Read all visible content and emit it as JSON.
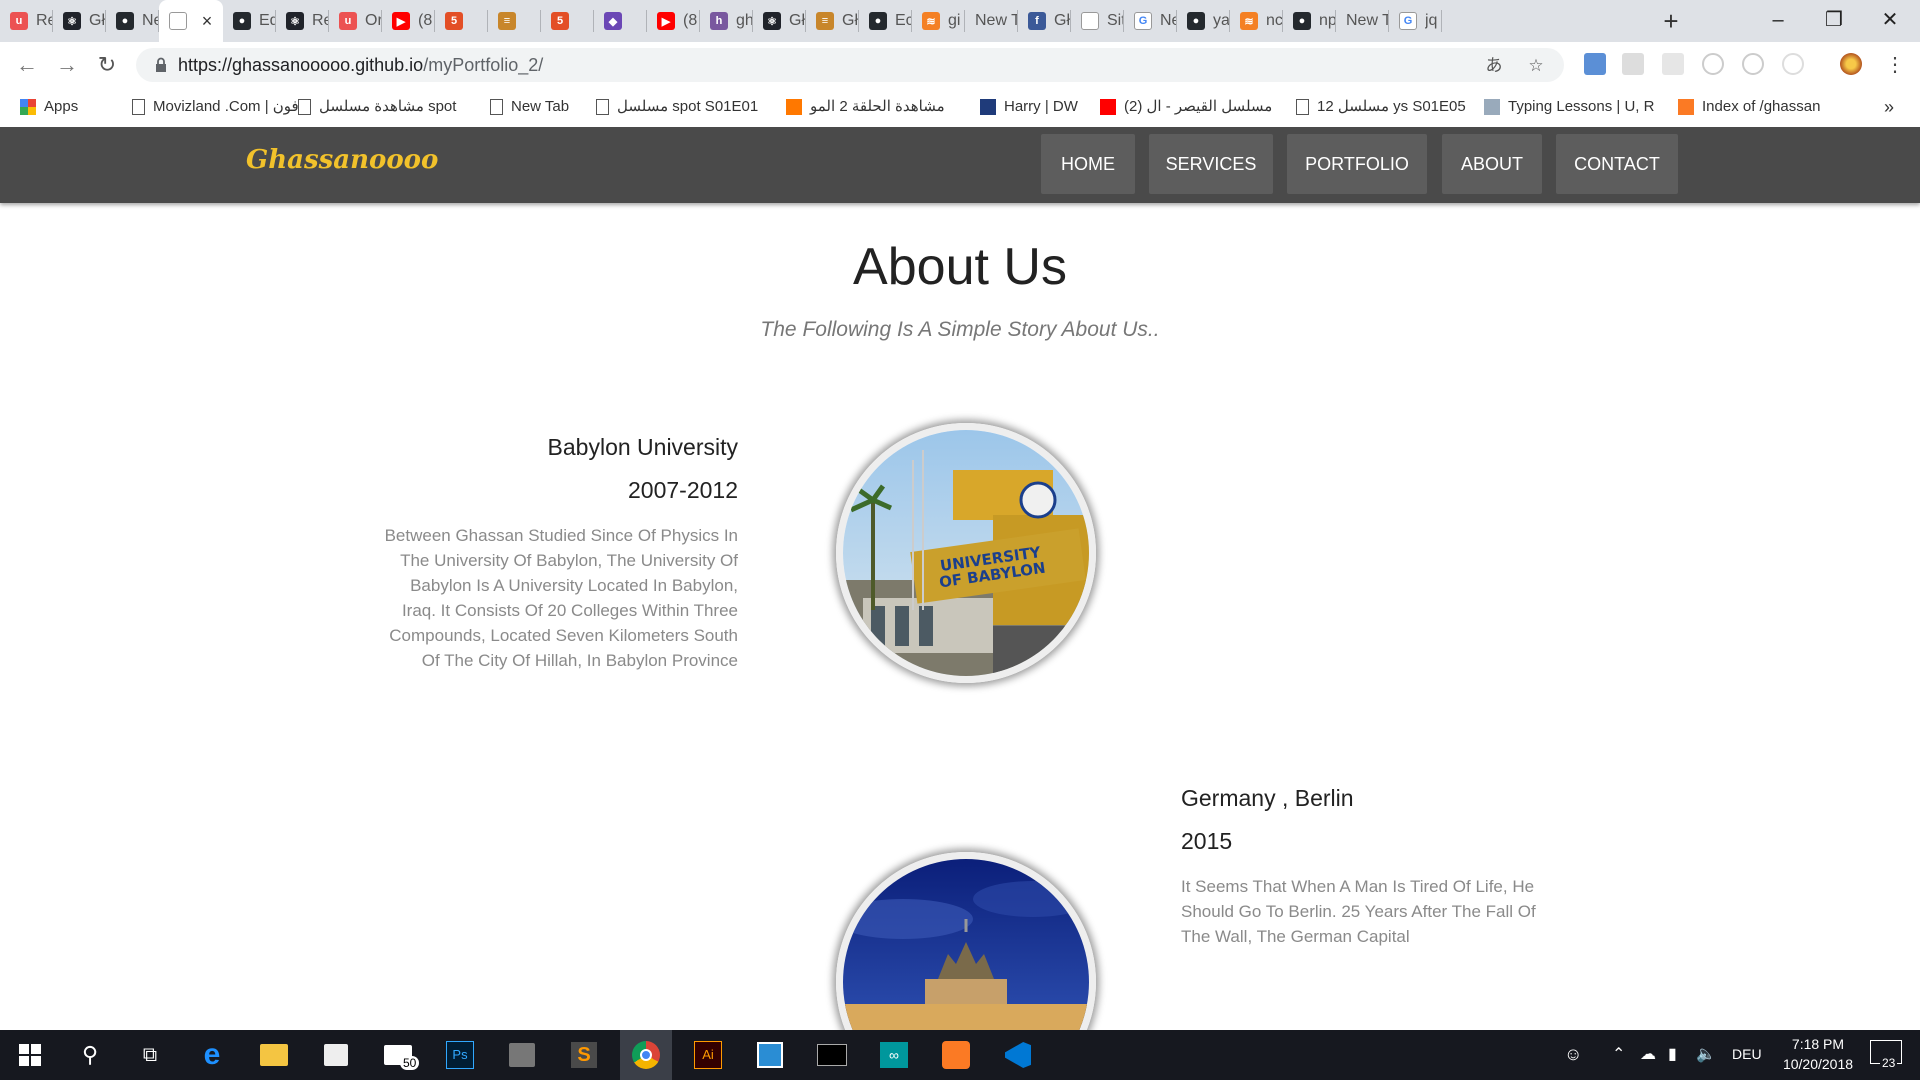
{
  "browser": {
    "tabs": [
      {
        "title": "Re",
        "favicon": "udemy-icon",
        "color": "#ec5252",
        "glyph": "u"
      },
      {
        "title": "Gł",
        "favicon": "react-icon",
        "color": "#20232a",
        "glyph": "⚛"
      },
      {
        "title": "Ne",
        "favicon": "github-icon",
        "color": "#24292e",
        "glyph": "●"
      },
      {
        "title": "",
        "favicon": "page-icon",
        "color": "#ffffff",
        "glyph": "",
        "active": true
      },
      {
        "title": "Ed",
        "favicon": "github-icon",
        "color": "#24292e",
        "glyph": "●"
      },
      {
        "title": "Re",
        "favicon": "react-icon",
        "color": "#20232a",
        "glyph": "⚛"
      },
      {
        "title": "Or",
        "favicon": "udemy-icon",
        "color": "#ec5252",
        "glyph": "u"
      },
      {
        "title": "(8",
        "favicon": "youtube-icon",
        "color": "#ff0000",
        "glyph": "▶"
      },
      {
        "title": "",
        "favicon": "html5-icon",
        "color": "#e34f26",
        "glyph": "5"
      },
      {
        "title": "",
        "favicon": "burger-icon",
        "color": "#c8862b",
        "glyph": "≡"
      },
      {
        "title": "",
        "favicon": "html5-icon",
        "color": "#e34f26",
        "glyph": "5"
      },
      {
        "title": "",
        "favicon": "app-icon",
        "color": "#6b47b5",
        "glyph": "◆"
      },
      {
        "title": "(8",
        "favicon": "youtube-icon",
        "color": "#ff0000",
        "glyph": "▶"
      },
      {
        "title": "gh",
        "favicon": "heroku-icon",
        "color": "#79589f",
        "glyph": "h"
      },
      {
        "title": "Gł",
        "favicon": "react-icon",
        "color": "#20232a",
        "glyph": "⚛"
      },
      {
        "title": "Gł",
        "favicon": "burger-icon",
        "color": "#c8862b",
        "glyph": "≡"
      },
      {
        "title": "Ec",
        "favicon": "github-icon",
        "color": "#24292e",
        "glyph": "●"
      },
      {
        "title": "gi",
        "favicon": "stackoverflow-icon",
        "color": "#f48024",
        "glyph": "≋"
      },
      {
        "title": "New Ta",
        "favicon": "none",
        "color": "#dee1e6",
        "glyph": ""
      },
      {
        "title": "Gł",
        "favicon": "facebook-icon",
        "color": "#3b5998",
        "glyph": "f"
      },
      {
        "title": "Sit",
        "favicon": "page-icon",
        "color": "#ffffff",
        "glyph": ""
      },
      {
        "title": "Ne",
        "favicon": "google-icon",
        "color": "#ffffff",
        "glyph": "G"
      },
      {
        "title": "ya",
        "favicon": "github-icon",
        "color": "#24292e",
        "glyph": "●"
      },
      {
        "title": "nc",
        "favicon": "stackoverflow-icon",
        "color": "#f48024",
        "glyph": "≋"
      },
      {
        "title": "np",
        "favicon": "github-icon",
        "color": "#24292e",
        "glyph": "●"
      },
      {
        "title": "New Ta",
        "favicon": "none",
        "color": "#dee1e6",
        "glyph": ""
      },
      {
        "title": "jq",
        "favicon": "google-icon",
        "color": "#ffffff",
        "glyph": "G"
      }
    ],
    "url_host": "https://ghassanooooo.github.io",
    "url_path": "/myPortfolio_2/",
    "bookmarks": [
      {
        "label": "Apps",
        "icon": "apps-grid-icon"
      },
      {
        "label": "Movizland .Com | فون",
        "icon": "page-icon"
      },
      {
        "label": "مشاهدة مسلسل spot",
        "icon": "page-icon"
      },
      {
        "label": "New Tab",
        "icon": "page-icon"
      },
      {
        "label": "مسلسل spot S01E01",
        "icon": "page-icon"
      },
      {
        "label": "مشاهدة الحلقة 2 المو",
        "icon": "avast-icon"
      },
      {
        "label": "Harry | DW",
        "icon": "dw-icon"
      },
      {
        "label": "(2) مسلسل القيصر - ال",
        "icon": "youtube-icon"
      },
      {
        "label": "مسلسل 12 ys S01E05",
        "icon": "page-icon"
      },
      {
        "label": "Typing Lessons | U, R",
        "icon": "typing-icon"
      },
      {
        "label": "Index of /ghassan",
        "icon": "xampp-icon"
      }
    ],
    "bookmarks_more": "»"
  },
  "site": {
    "logo": "Ghassanoooo",
    "menu": [
      "HOME",
      "SERVICES",
      "PORTFOLIO",
      "ABOUT",
      "CONTACT"
    ],
    "section_title": "About Us",
    "section_subtitle": "The Following Is A Simple Story About Us..",
    "timeline": [
      {
        "heading": "Babylon University",
        "date": "2007-2012",
        "text": "Between Ghassan Studied Since Of Physics In The University Of Babylon, The University Of Babylon Is A University Located In Babylon, Iraq. It Consists Of 20 Colleges Within Three Compounds, Located Seven Kilometers South Of The City Of Hillah, In Babylon Province",
        "image_text": "UNIVERSITY OF BABYLON"
      },
      {
        "heading": "Germany , Berlin",
        "date": "2015",
        "text": "It Seems That When A Man Is Tired Of Life, He Should Go To Berlin. 25 Years After The Fall Of The Wall, The German Capital"
      }
    ]
  },
  "taskbar": {
    "mail_badge": "50",
    "language": "DEU",
    "time": "7:18 PM",
    "date": "10/20/2018",
    "notifications": "23"
  }
}
